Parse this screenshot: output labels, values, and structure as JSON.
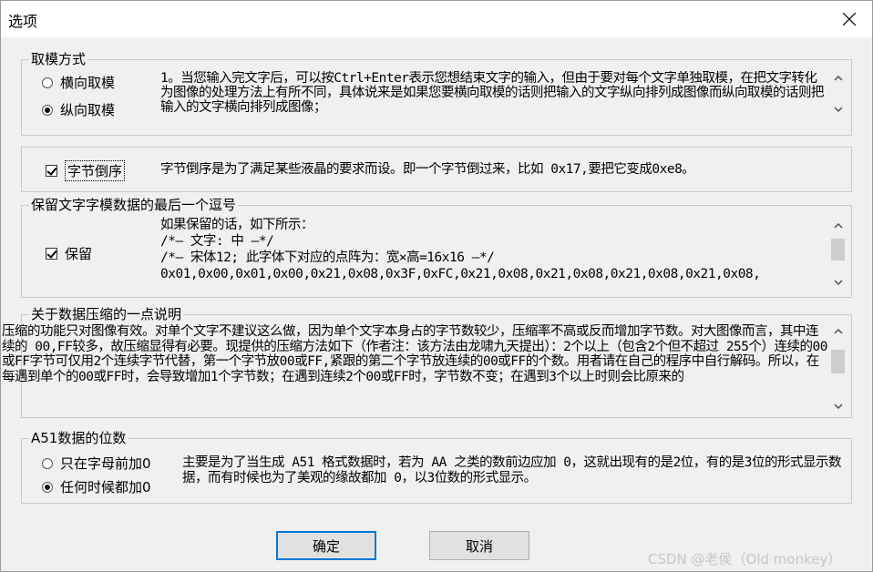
{
  "window": {
    "title": "选项"
  },
  "mode_group": {
    "legend": "取模方式",
    "option_horizontal": "横向取模",
    "option_vertical": "纵向取模",
    "selected": "纵向取模",
    "description": "1。当您输入完文字后，可以按Ctrl+Enter表示您想结束文字的输入，但由于要对每个文字单独取模，在把文字转化为图像的处理方法上有所不同，具体说来是如果您要横向取模的话则把输入的文字纵向排列成图像而纵向取模的话则把输入的文字横向排列成图像；"
  },
  "byte_reverse": {
    "label": "字节倒序",
    "checked": true,
    "description": "字节倒序是为了满足某些液晶的要求而设。即一个字节倒过来，比如 0x17,要把它变成0xe8。"
  },
  "keep_comma": {
    "legend": "保留文字字模数据的最后一个逗号",
    "label": "保留",
    "checked": true,
    "lines": [
      "如果保留的话，如下所示：",
      "/*—  文字:  中  —*/",
      "/*—  宋体12;  此字体下对应的点阵为：宽×高=16x16   —*/",
      "0x01,0x00,0x01,0x00,0x21,0x08,0x3F,0xFC,0x21,0x08,0x21,0x08,0x21,0x08,0x21,0x08,"
    ]
  },
  "compression": {
    "legend": "关于数据压缩的一点说明",
    "description": "压缩的功能只对图像有效。对单个文字不建议这么做，因为单个文字本身占的字节数较少，压缩率不高或反而增加字节数。对大图像而言，其中连续的 00,FF较多，故压缩显得有必要。现提供的压缩方法如下（作者注：该方法由龙啸九天提出）：2个以上（包含2个但不超过 255个）连续的00或FF字节可仅用2个连续字节代替，第一个字节放00或FF,紧跟的第二个字节放连续的00或FF的个数。用者请在自己的程序中自行解码。所以，在每遇到单个的00或FF时，会导致增加1个字节数；在遇到连续2个00或FF时，字节数不变；在遇到3个以上时则会比原来的"
  },
  "a51_digits": {
    "legend": "A51数据的位数",
    "option_only_letter": "只在字母前加0",
    "option_always": "任何时候都加0",
    "selected": "任何时候都加0",
    "description": "主要是为了当生成 A51 格式数据时，若为 AA 之类的数前边应加 0，这就出现有的是2位，有的是3位的形式显示数据，而有时候也为了美观的缘故都加 0，以3位数的形式显示。"
  },
  "buttons": {
    "ok": "确定",
    "cancel": "取消"
  },
  "watermark": "CSDN @老侯（Old monkey）",
  "icons": {
    "close": "close-icon",
    "scroll_up": "chevron-up-icon",
    "scroll_down": "chevron-down-icon"
  }
}
